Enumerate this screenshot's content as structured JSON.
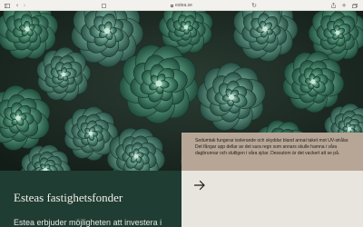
{
  "browser": {
    "url": "estea.se",
    "icons": {
      "sidebar": "sidebar-icon",
      "back": "back-icon",
      "forward": "forward-icon",
      "tab": "tab-icon",
      "reload": "reload-icon",
      "share": "share-icon",
      "new_tab": "plus-icon",
      "tabs": "tabs-icon"
    }
  },
  "hero": {
    "image": "succulent-plants-photo"
  },
  "info_box": {
    "text": "Sedumtak fungerar isolerande och skyddar bland annat taket mot UV-strålar. Det fångar upp dellar av det sura regn som annars skulle hamna i våra dagbrunnar och slutligen i våra sjöar. Dessutom är det vackert att se på."
  },
  "fund": {
    "title": "Esteas fastighetsfonder",
    "subtitle": "Estea erbjuder möjligheten att investera i"
  },
  "cta": {
    "icon": "arrow-right-icon"
  },
  "colors": {
    "dark_green": "#1f3d33",
    "tan": "#b7a695",
    "cream": "#e8e4de"
  }
}
